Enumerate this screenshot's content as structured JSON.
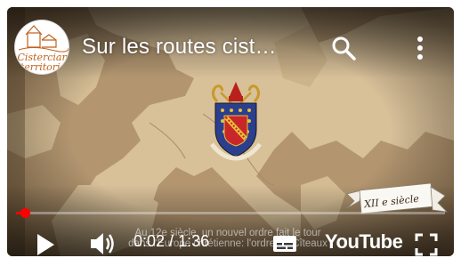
{
  "video": {
    "title": "Sur les routes cist…",
    "channel_avatar_lines": [
      "Cistercian",
      "territoris"
    ],
    "century_label": "XII e siècle",
    "subtitles": {
      "line1": "Au 12e siècle, un nouvel ordre fait le tour",
      "line2": "dans l'Europe chrétienne: l'ordre de Cîteaux"
    }
  },
  "controls": {
    "current_time": "0:02",
    "separator": " / ",
    "duration": "1:36",
    "progress": 0.02,
    "brand": "YouTube"
  },
  "colors": {
    "accent": "#ff0000",
    "controls": "#ffffff",
    "map_sea": "#b49a72",
    "map_land": "#d9c29a"
  },
  "icons": [
    "search-icon",
    "more-vertical-icon",
    "play-icon",
    "volume-icon",
    "captions-icon",
    "youtube-logo-icon",
    "fullscreen-icon",
    "coat-of-arms-icon"
  ]
}
